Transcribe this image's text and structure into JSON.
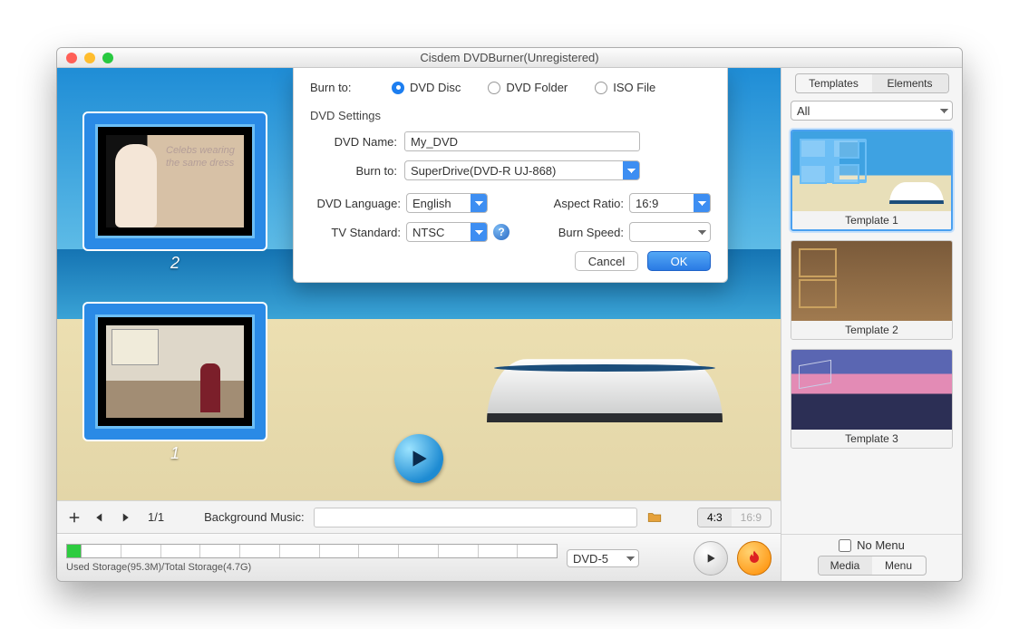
{
  "window_title": "Cisdem DVDBurner(Unregistered)",
  "burn_to_label": "Burn to:",
  "burn_to_options": {
    "disc": "DVD Disc",
    "folder": "DVD Folder",
    "iso": "ISO File"
  },
  "burn_to_selected": "disc",
  "section_dvd_settings": "DVD Settings",
  "dvd_name_label": "DVD Name:",
  "dvd_name_value": "My_DVD",
  "burn_drive_label": "Burn to:",
  "burn_drive_value": "SuperDrive(DVD-R   UJ-868)",
  "dvd_language_label": "DVD Language:",
  "dvd_language_value": "English",
  "aspect_ratio_label": "Aspect Ratio:",
  "aspect_ratio_value": "16:9",
  "tv_standard_label": "TV Standard:",
  "tv_standard_value": "NTSC",
  "burn_speed_label": "Burn Speed:",
  "burn_speed_value": "",
  "cancel_label": "Cancel",
  "ok_label": "OK",
  "stamp_overlay_text": "Celebs wearing the same dress",
  "stamp_numbers": {
    "first": "2",
    "second": "1"
  },
  "page_indicator": "1/1",
  "bg_music_label": "Background Music:",
  "aspect_opts": {
    "on": "4:3",
    "off": "16:9"
  },
  "disc_type_value": "DVD-5",
  "storage_text": "Used Storage(95.3M)/Total Storage(4.7G)",
  "side_tabs": {
    "templates": "Templates",
    "elements": "Elements",
    "active": "elements"
  },
  "filter_value": "All",
  "templates": [
    {
      "name": "Template 1",
      "cls": "t1",
      "selected": true
    },
    {
      "name": "Template 2",
      "cls": "t2",
      "selected": false
    },
    {
      "name": "Template 3",
      "cls": "t3",
      "selected": false
    }
  ],
  "no_menu_label": "No Menu",
  "bottom_tabs": {
    "media": "Media",
    "menu": "Menu",
    "active": "media"
  }
}
